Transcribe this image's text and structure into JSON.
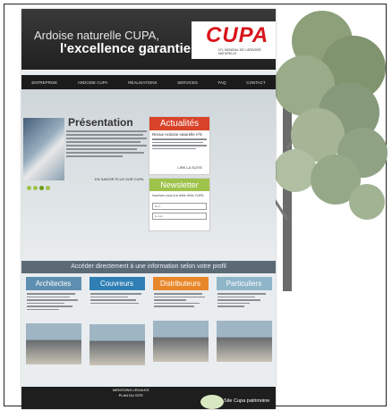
{
  "header": {
    "tagline_line1": "Ardoise naturelle CUPA,",
    "tagline_line2": "l'excellence garantie",
    "logo_text": "CUPA",
    "logo_subtext": "N°1 MONDIAL DE L'ARDOISE NATURELLE"
  },
  "nav": [
    "ENTREPRISE",
    "ARDOISE CUPA",
    "RÉALISATIONS",
    "SERVICES",
    "FAQ",
    "CONTACT"
  ],
  "presentation": {
    "title": "Présentation",
    "more": "EN SAVOIR PLUS SUR CUPA"
  },
  "news": {
    "title": "Actualités",
    "headline": "Revue Ardoise naturelle nº6",
    "more": "LIRE LA SUITE"
  },
  "newsletter": {
    "title": "Newsletter",
    "intro": "Inscrivez-vous à la lettre d'info CUPA",
    "placeholder1": "Nom",
    "placeholder2": "E-mail"
  },
  "direct_bar": "Accéder directement à une information selon votre profil",
  "profiles": [
    {
      "label": "Architectes",
      "color": "#5f8fb0"
    },
    {
      "label": "Couvreurs",
      "color": "#2f7fb5"
    },
    {
      "label": "Distributeurs",
      "color": "#e8872a"
    },
    {
      "label": "Particuliers",
      "color": "#8fb5c9"
    }
  ],
  "footer": {
    "link1": "MENTIONS LÉGALES",
    "link2": "PLAN DU SITE",
    "partner": "Site Cupa patrimoine"
  }
}
